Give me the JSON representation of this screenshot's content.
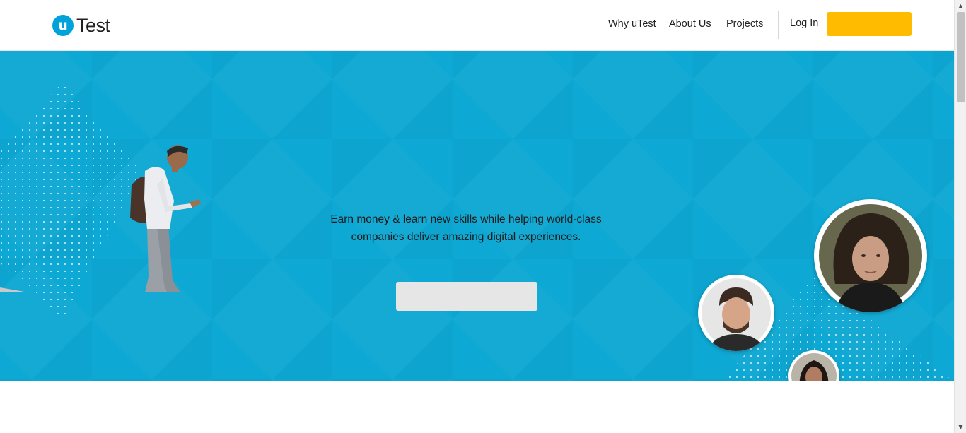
{
  "brand": {
    "logo_mark": "u",
    "logo_text": "Test"
  },
  "nav": {
    "items": [
      {
        "label": "Why uTest"
      },
      {
        "label": "About Us"
      },
      {
        "label": "Projects"
      }
    ],
    "login_label": "Log In",
    "cta_label": ""
  },
  "hero": {
    "tagline_line1": "Earn money & learn new skills while helping world-class",
    "tagline_line2": "companies deliver amazing digital experiences.",
    "button_label": ""
  },
  "colors": {
    "brand_blue": "#00a3d9",
    "hero_background": "#0fabd6",
    "cta_yellow": "#ffbb00",
    "hero_button": "#e6e6e6"
  },
  "icons": {
    "scroll_up": "▲",
    "scroll_down": "▼"
  }
}
